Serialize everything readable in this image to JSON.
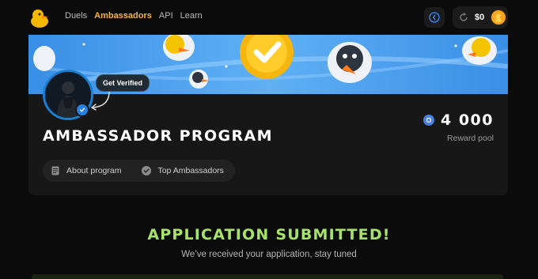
{
  "nav": {
    "items": [
      {
        "label": "Duels",
        "active": false
      },
      {
        "label": "Ambassadors",
        "active": true
      },
      {
        "label": "API",
        "active": false
      },
      {
        "label": "Learn",
        "active": false
      }
    ]
  },
  "wallet": {
    "balance": "$0"
  },
  "profile": {
    "get_verified_label": "Get Verified"
  },
  "program": {
    "title": "AMBASSADOR PROGRAM",
    "reward_amount": "4 000",
    "reward_label": "Reward pool",
    "pills": [
      "About program",
      "Top Ambassadors"
    ]
  },
  "application": {
    "title": "APPLICATION SUBMITTED!",
    "subtitle": "We’ve received your application, stay tuned"
  },
  "colors": {
    "accent_orange": "#f5b23a",
    "success_green": "#a7e36a",
    "banner_blue": "#2f8de4",
    "verified_blue": "#2a80e0"
  }
}
